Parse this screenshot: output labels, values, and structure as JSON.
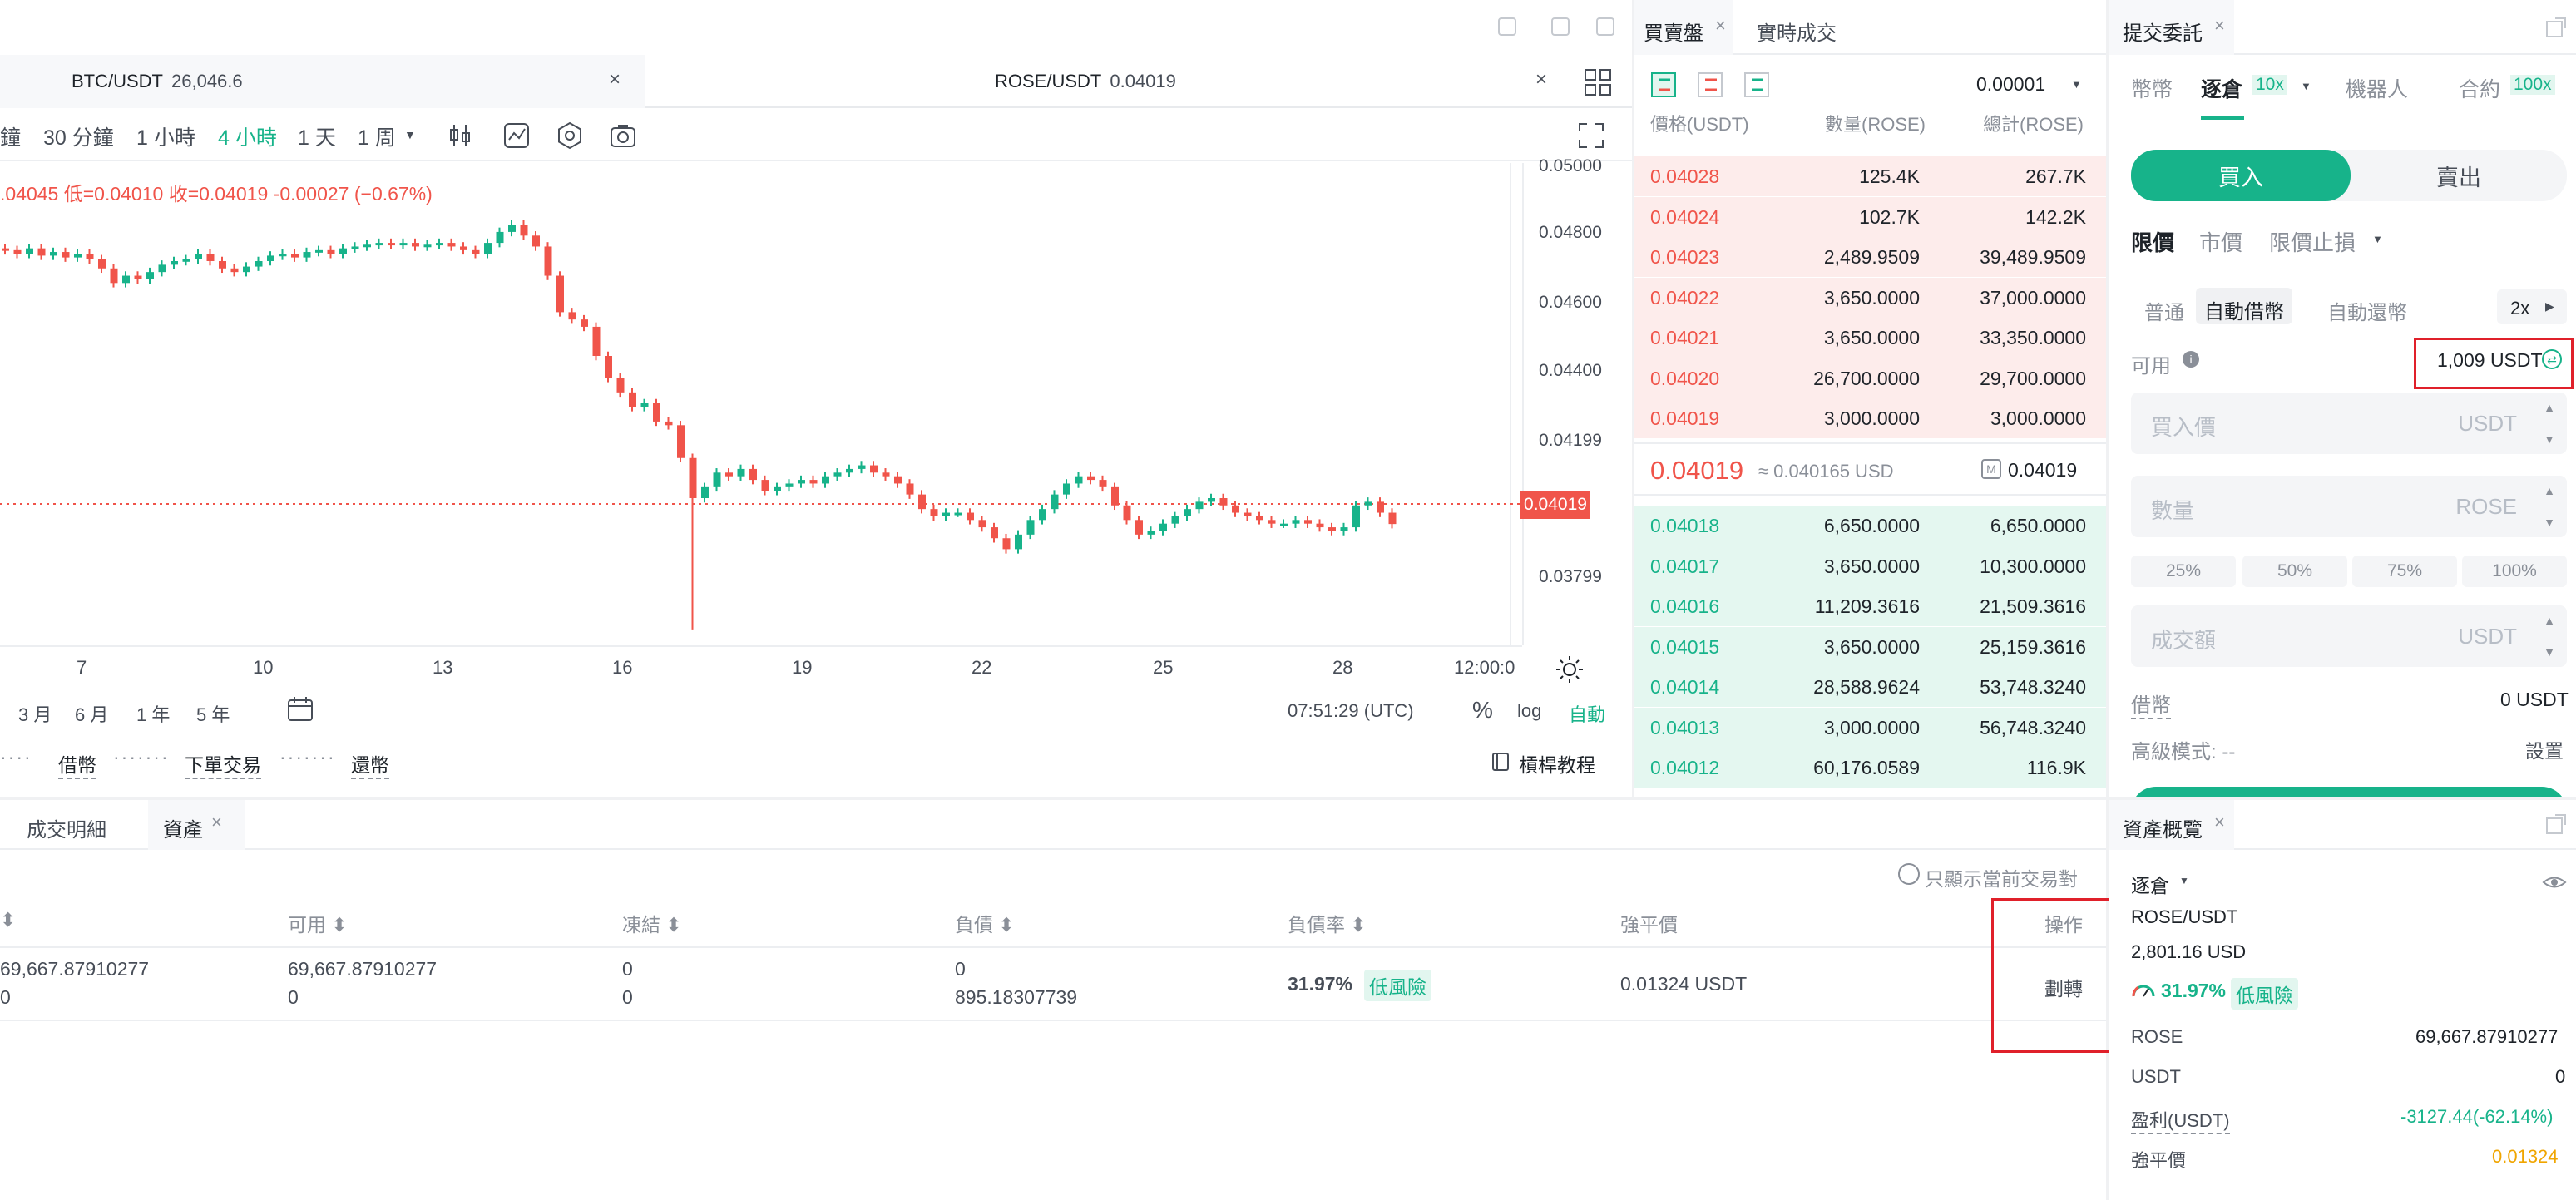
{
  "chart": {
    "tabs": [
      {
        "symbol": "BTC/USDT",
        "price": "26,046.6"
      },
      {
        "symbol": "ROSE/USDT",
        "price": "0.04019"
      }
    ],
    "timeframes": [
      "鐘",
      "30 分鐘",
      "1 小時",
      "4 小時",
      "1 天",
      "1 周"
    ],
    "active_timeframe": "4 小時",
    "ohlc_text": ".04045 低=0.04010 收=0.04019 -0.00027 (−0.67%)",
    "y_ticks": [
      "0.05000",
      "0.04800",
      "0.04600",
      "0.04400",
      "0.04199",
      "0.03799"
    ],
    "current_price": "0.04019",
    "x_ticks": [
      "7",
      "10",
      "13",
      "16",
      "19",
      "22",
      "25",
      "28",
      "12:00:0"
    ],
    "ranges": [
      "3 月",
      "6 月",
      "1 年",
      "5 年"
    ],
    "clock": "07:51:29 (UTC)",
    "percent_label": "%",
    "log_label": "log",
    "auto_label": "自動",
    "guide": [
      "借幣",
      "下單交易",
      "還幣"
    ],
    "tutorial": "槓桿教程",
    "candles_close": [
      0.0477,
      0.0476,
      0.04775,
      0.04755,
      0.04765,
      0.0475,
      0.0476,
      0.04745,
      0.0472,
      0.0468,
      0.047,
      0.0469,
      0.0471,
      0.0473,
      0.0474,
      0.04745,
      0.0476,
      0.0474,
      0.0472,
      0.0471,
      0.04725,
      0.0474,
      0.04755,
      0.0476,
      0.0475,
      0.04765,
      0.0477,
      0.0476,
      0.04775,
      0.0478,
      0.04785,
      0.0479,
      0.04785,
      0.0479,
      0.0478,
      0.04785,
      0.0479,
      0.0478,
      0.0477,
      0.0476,
      0.0479,
      0.0482,
      0.0484,
      0.0481,
      0.0478,
      0.047,
      0.046,
      0.0458,
      0.0456,
      0.0448,
      0.0442,
      0.0438,
      0.0434,
      0.0435,
      0.043,
      0.0429,
      0.042,
      0.0409,
      0.0412,
      0.0416,
      0.0415,
      0.0417,
      0.0414,
      0.0411,
      0.0412,
      0.0413,
      0.0414,
      0.0413,
      0.0415,
      0.0416,
      0.0417,
      0.0418,
      0.0416,
      0.0415,
      0.0413,
      0.041,
      0.0406,
      0.0404,
      0.0405,
      0.0405,
      0.0403,
      0.0401,
      0.0398,
      0.0395,
      0.0399,
      0.0403,
      0.0406,
      0.041,
      0.0413,
      0.0415,
      0.0414,
      0.0412,
      0.0407,
      0.0403,
      0.0399,
      0.04,
      0.0402,
      0.0404,
      0.0406,
      0.0408,
      0.0409,
      0.0407,
      0.0405,
      0.0404,
      0.0403,
      0.0402,
      0.0402,
      0.0403,
      0.0402,
      0.0401,
      0.04,
      0.0401,
      0.0407,
      0.0408,
      0.0405,
      0.04019
    ]
  },
  "orderbook": {
    "tabs": [
      "買賣盤",
      "實時成交"
    ],
    "precision": "0.00001",
    "headers": [
      "價格(USDT)",
      "數量(ROSE)",
      "總計(ROSE)"
    ],
    "asks": [
      [
        "0.04028",
        "125.4K",
        "267.7K"
      ],
      [
        "0.04024",
        "102.7K",
        "142.2K"
      ],
      [
        "0.04023",
        "2,489.9509",
        "39,489.9509"
      ],
      [
        "0.04022",
        "3,650.0000",
        "37,000.0000"
      ],
      [
        "0.04021",
        "3,650.0000",
        "33,350.0000"
      ],
      [
        "0.04020",
        "26,700.0000",
        "29,700.0000"
      ],
      [
        "0.04019",
        "3,000.0000",
        "3,000.0000"
      ]
    ],
    "last_price": "0.04019",
    "last_usd": "≈ 0.040165 USD",
    "mark_price": "0.04019",
    "bids": [
      [
        "0.04018",
        "6,650.0000",
        "6,650.0000"
      ],
      [
        "0.04017",
        "3,650.0000",
        "10,300.0000"
      ],
      [
        "0.04016",
        "11,209.3616",
        "21,509.3616"
      ],
      [
        "0.04015",
        "3,650.0000",
        "25,159.3616"
      ],
      [
        "0.04014",
        "28,588.9624",
        "53,748.3240"
      ],
      [
        "0.04013",
        "3,000.0000",
        "56,748.3240"
      ],
      [
        "0.04012",
        "60,176.0589",
        "116.9K"
      ]
    ]
  },
  "entry": {
    "title": "提交委託",
    "modes": [
      "幣幣",
      "逐倉",
      "10x",
      "機器人",
      "合約",
      "100x"
    ],
    "buy": "買入",
    "sell": "賣出",
    "order_types": [
      "限價",
      "市價",
      "限價止損"
    ],
    "borrow_modes": [
      "普通",
      "自動借幣",
      "自動還幣"
    ],
    "leverage": "2x",
    "available_label": "可用",
    "available_value": "1,009 USDT",
    "price_placeholder": "買入價",
    "price_unit": "USDT",
    "qty_placeholder": "數量",
    "qty_unit": "ROSE",
    "percents": [
      "25%",
      "50%",
      "75%",
      "100%"
    ],
    "total_placeholder": "成交額",
    "total_unit": "USDT",
    "borrow_label": "借幣",
    "borrow_value": "0 USDT",
    "advanced_label": "高級模式: --",
    "settings": "設置"
  },
  "bottom": {
    "tabs": [
      "成交明細",
      "資產"
    ],
    "only_current": "只顯示當前交易對",
    "headers": [
      "可用",
      "凍結",
      "負債",
      "負債率",
      "強平價",
      "操作"
    ],
    "row": {
      "total_a": "69,667.87910277",
      "total_b": "0",
      "avail_a": "69,667.87910277",
      "avail_b": "0",
      "frozen_a": "0",
      "frozen_b": "0",
      "debt_a": "0",
      "debt_b": "895.18307739",
      "ratio": "31.97%",
      "risk": "低風險",
      "liq": "0.01324 USDT",
      "action": "劃轉"
    }
  },
  "overview": {
    "title": "資產概覽",
    "mode": "逐倉",
    "pair": "ROSE/USDT",
    "value": "2,801.16 USD",
    "ratio": "31.97%",
    "risk": "低風險",
    "rows": [
      {
        "label": "ROSE",
        "value": "69,667.87910277"
      },
      {
        "label": "USDT",
        "value": "0"
      },
      {
        "label": "盈利(USDT)",
        "value": "-3127.44(-62.14%)"
      },
      {
        "label": "強平價",
        "value": "0.01324"
      }
    ]
  },
  "colors": {
    "up": "#17b38a",
    "down": "#f0544a",
    "accent": "#17b38a",
    "warn": "#f0a500",
    "highlight": "#e0202a"
  }
}
